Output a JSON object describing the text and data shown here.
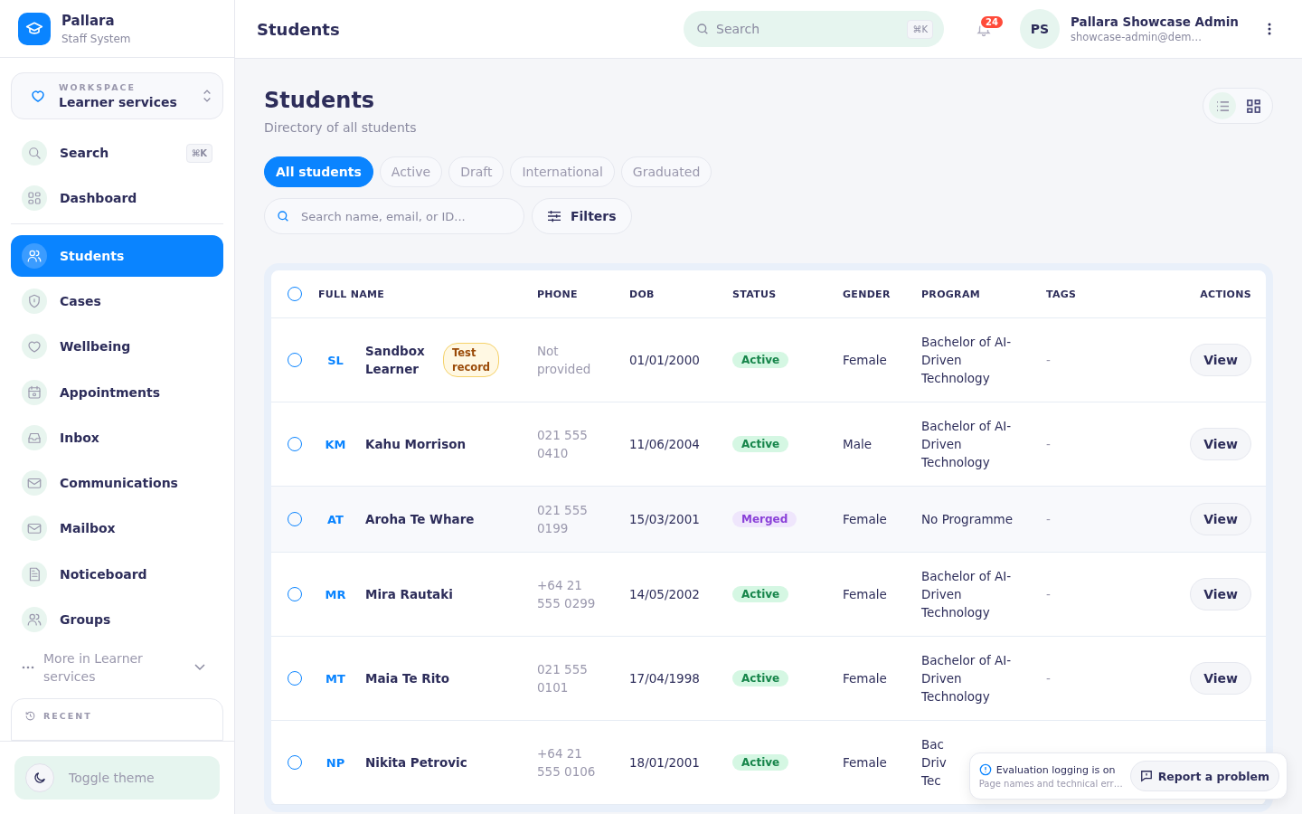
{
  "brand": {
    "name": "Pallara",
    "subtitle": "Staff System"
  },
  "workspace": {
    "label": "WORKSPACE",
    "value": "Learner services"
  },
  "sidebar": {
    "items": [
      {
        "label": "Search",
        "shortcut": "⌘K",
        "selected": false
      },
      {
        "label": "Dashboard",
        "selected": false
      },
      {
        "label": "Students",
        "selected": true
      },
      {
        "label": "Cases",
        "selected": false
      },
      {
        "label": "Wellbeing",
        "selected": false
      },
      {
        "label": "Appointments",
        "selected": false
      },
      {
        "label": "Inbox",
        "selected": false
      },
      {
        "label": "Communications",
        "selected": false
      },
      {
        "label": "Mailbox",
        "selected": false
      },
      {
        "label": "Noticeboard",
        "selected": false
      },
      {
        "label": "Groups",
        "selected": false
      }
    ],
    "more": "More in Learner services",
    "recent": "RECENT",
    "toggle_theme": "Toggle theme"
  },
  "topbar": {
    "title": "Students",
    "search": {
      "placeholder": "Search",
      "shortcut": "⌘K"
    },
    "notifications": "24",
    "user": {
      "initials": "PS",
      "name": "Pallara Showcase Admin",
      "email": "showcase-admin@dem…"
    }
  },
  "page": {
    "title": "Students",
    "subtitle": "Directory of all students"
  },
  "view_toggle": [
    {
      "kind": "list",
      "selected": true
    },
    {
      "kind": "grid",
      "selected": false
    }
  ],
  "tabs": [
    {
      "label": "All students",
      "selected": true
    },
    {
      "label": "Active",
      "selected": false
    },
    {
      "label": "Draft",
      "selected": false
    },
    {
      "label": "International",
      "selected": false
    },
    {
      "label": "Graduated",
      "selected": false
    }
  ],
  "filter_search": {
    "placeholder": "Search name, email, or ID..."
  },
  "filters_button": "Filters",
  "table": {
    "select_all": {
      "checked": false
    },
    "columns": [
      "FULL NAME",
      "PHONE",
      "DOB",
      "STATUS",
      "GENDER",
      "PROGRAM",
      "TAGS",
      "ACTIONS"
    ],
    "rows": [
      {
        "selected": false,
        "initials": "SL",
        "name": "Sandbox Learner",
        "badge": "Test record",
        "phone": "Not provided",
        "dob": "01/01/2000",
        "status": {
          "label": "Active",
          "kind": "active"
        },
        "gender": "Female",
        "program": [
          "Bachelor of AI-Driven Technology"
        ],
        "tags": [
          "-"
        ],
        "action": "View"
      },
      {
        "selected": false,
        "initials": "KM",
        "name": "Kahu Morrison",
        "phone": "021 555 0410",
        "dob": "11/06/2004",
        "status": {
          "label": "Active",
          "kind": "active"
        },
        "gender": "Male",
        "program": [
          "Bachelor of AI-Driven Technology"
        ],
        "tags": [
          "-"
        ],
        "action": "View"
      },
      {
        "selected": false,
        "initials": "AT",
        "name": "Aroha Te Whare",
        "phone": "021 555 0199",
        "dob": "15/03/2001",
        "status": {
          "label": "Merged",
          "kind": "merged"
        },
        "gender": "Female",
        "program": [
          "No Programme"
        ],
        "tags": [
          "-"
        ],
        "action": "View"
      },
      {
        "selected": false,
        "initials": "MR",
        "name": "Mira Rautaki",
        "phone": "+64 21 555 0299",
        "dob": "14/05/2002",
        "status": {
          "label": "Active",
          "kind": "active"
        },
        "gender": "Female",
        "program": [
          "Bachelor of AI-Driven Technology"
        ],
        "tags": [
          "-"
        ],
        "action": "View"
      },
      {
        "selected": false,
        "initials": "MT",
        "name": "Maia Te Rito",
        "phone": "021 555 0101",
        "dob": "17/04/1998",
        "status": {
          "label": "Active",
          "kind": "active"
        },
        "gender": "Female",
        "program": [
          "Bachelor of AI-Driven Technology"
        ],
        "tags": [
          "-"
        ],
        "action": "View"
      },
      {
        "selected": false,
        "initials": "NP",
        "name": "Nikita Petrovic",
        "phone": "+64 21 555 0106",
        "dob": "18/01/2001",
        "status": {
          "label": "Active",
          "kind": "active"
        },
        "gender": "Female",
        "program": [
          "Bac",
          "Driv",
          "Tec"
        ],
        "tags": []
      }
    ]
  },
  "toast": {
    "title": "Evaluation logging is on",
    "text": "Page names and technical err…",
    "button": "Report a problem"
  }
}
